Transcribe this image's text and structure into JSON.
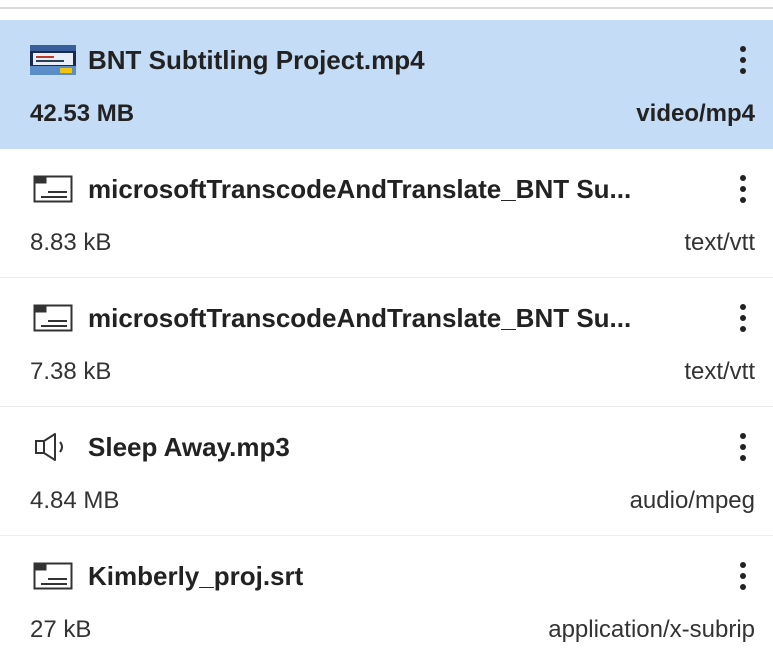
{
  "files": [
    {
      "name": "BNT Subtitling Project.mp4",
      "size": "42.53 MB",
      "type": "video/mp4",
      "icon": "video-thumbnail-icon",
      "selected": true
    },
    {
      "name": "microsoftTranscodeAndTranslate_BNT Su...",
      "size": "8.83 kB",
      "type": "text/vtt",
      "icon": "subtitle-file-icon",
      "selected": false
    },
    {
      "name": "microsoftTranscodeAndTranslate_BNT Su...",
      "size": "7.38 kB",
      "type": "text/vtt",
      "icon": "subtitle-file-icon",
      "selected": false
    },
    {
      "name": "Sleep Away.mp3",
      "size": "4.84 MB",
      "type": "audio/mpeg",
      "icon": "speaker-icon",
      "selected": false
    },
    {
      "name": "Kimberly_proj.srt",
      "size": "27 kB",
      "type": "application/x-subrip",
      "icon": "subtitle-file-icon",
      "selected": false
    }
  ],
  "colors": {
    "selected_bg": "#c5dcf6",
    "text": "#222222",
    "divider": "#ececec"
  }
}
